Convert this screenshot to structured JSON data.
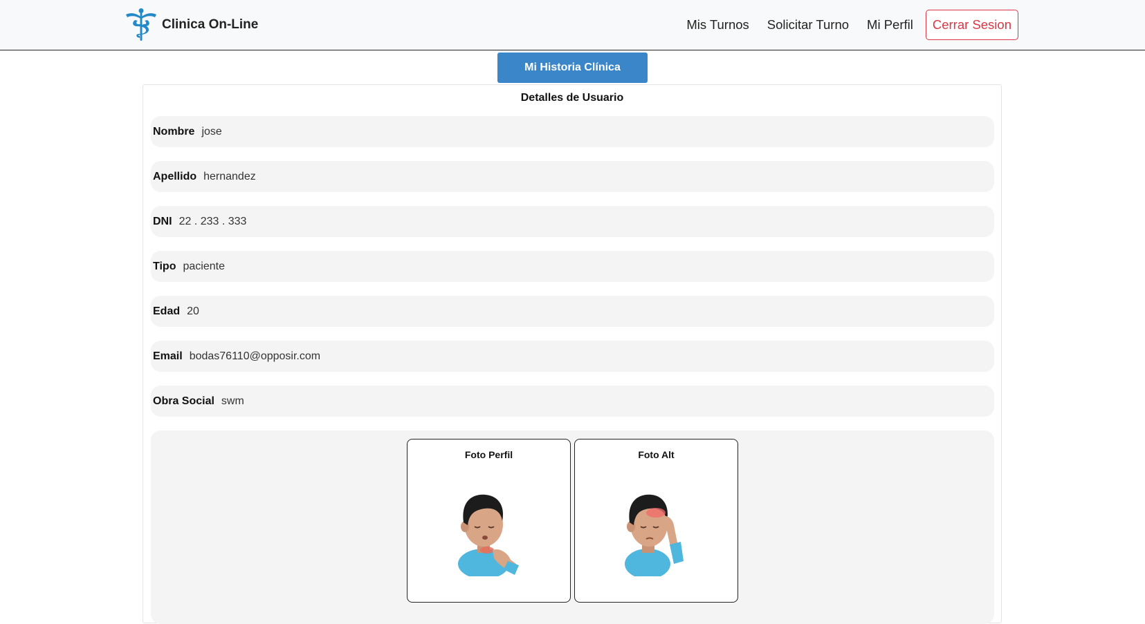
{
  "navbar": {
    "brand": "Clinica On-Line",
    "brand_icon": "caduceus-icon",
    "links": [
      "Mis Turnos",
      "Solicitar Turno",
      "Mi Perfil"
    ],
    "logout": "Cerrar Sesion",
    "logout_color": "#dc3545"
  },
  "history_button": "Mi Historia Clínica",
  "details": {
    "title": "Detalles de Usuario",
    "fields": [
      {
        "label": "Nombre",
        "value": "jose"
      },
      {
        "label": "Apellido",
        "value": "hernandez"
      },
      {
        "label": "DNI",
        "value": "22 . 233 . 333"
      },
      {
        "label": "Tipo",
        "value": "paciente"
      },
      {
        "label": "Edad",
        "value": "20"
      },
      {
        "label": "Email",
        "value": "bodas76110@opposir.com"
      },
      {
        "label": "Obra Social",
        "value": "swm"
      }
    ]
  },
  "photos": [
    {
      "title": "Foto Perfil",
      "image": "sick-man-throat-avatar"
    },
    {
      "title": "Foto Alt",
      "image": "sick-man-headache-avatar"
    }
  ],
  "colors": {
    "accent": "#3a86c8",
    "logo": "#2389c9"
  }
}
